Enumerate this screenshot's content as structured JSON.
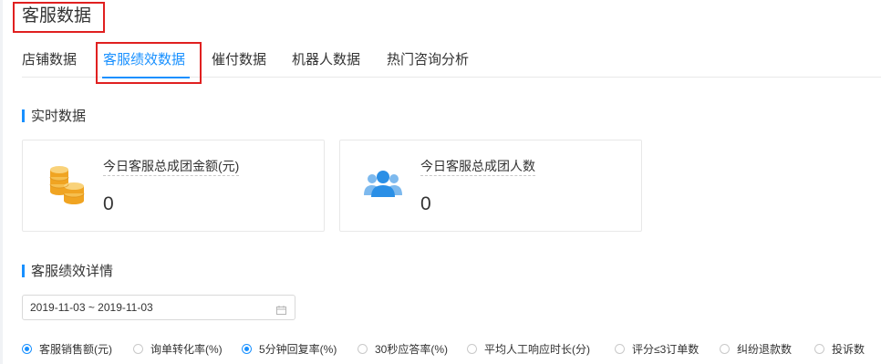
{
  "page": {
    "title": "客服数据"
  },
  "tabs": [
    {
      "label": "店铺数据",
      "active": false
    },
    {
      "label": "客服绩效数据",
      "active": true
    },
    {
      "label": "催付数据",
      "active": false
    },
    {
      "label": "机器人数据",
      "active": false
    },
    {
      "label": "热门咨询分析",
      "active": false
    }
  ],
  "realtime": {
    "heading": "实时数据",
    "cards": [
      {
        "label": "今日客服总成团金额(元)",
        "value": "0",
        "icon": "coins-icon"
      },
      {
        "label": "今日客服总成团人数",
        "value": "0",
        "icon": "users-icon"
      }
    ]
  },
  "performance": {
    "heading": "客服绩效详情",
    "date_range": "2019-11-03 ~ 2019-11-03",
    "metrics": [
      {
        "label": "客服销售额(元)",
        "checked": true
      },
      {
        "label": "询单转化率(%)",
        "checked": false
      },
      {
        "label": "5分钟回复率(%)",
        "checked": true
      },
      {
        "label": "30秒应答率(%)",
        "checked": false
      },
      {
        "label": "平均人工响应时长(分)",
        "checked": false
      },
      {
        "label": "评分≤3订单数",
        "checked": false
      },
      {
        "label": "纠纷退款数",
        "checked": false
      },
      {
        "label": "投诉数",
        "checked": false
      }
    ]
  },
  "colors": {
    "accent": "#1890ff",
    "highlight_border": "#e02020",
    "coins": "#f0a422",
    "users": "#2a8fe6"
  }
}
